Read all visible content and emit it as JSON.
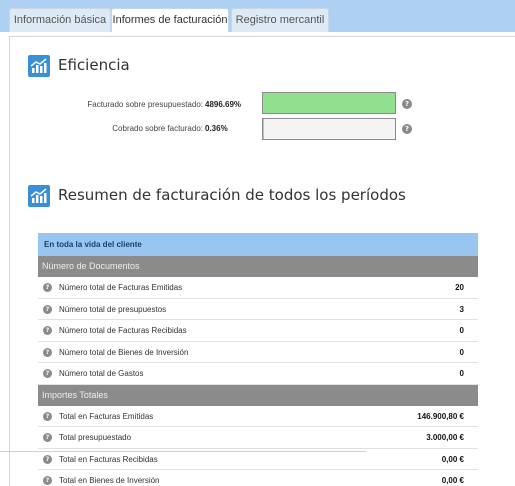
{
  "tabs": [
    {
      "label": "Información básica"
    },
    {
      "label": "Informes de facturación"
    },
    {
      "label": "Registro mercantil"
    }
  ],
  "efficiency": {
    "title": "Eficiencia",
    "rows": [
      {
        "label": "Facturado sobre presupuestado:",
        "value": "4896.69%",
        "fill_percent": 100,
        "fill_color": "#90e08f"
      },
      {
        "label": "Cobrado sobre facturado:",
        "value": "0.36%",
        "fill_percent": 0.36,
        "fill_color": "#90e08f"
      }
    ],
    "help_glyph": "?"
  },
  "summary": {
    "title": "Resumen de facturación de todos los períodos",
    "header": "En toda la vida del cliente",
    "groups": [
      {
        "label": "Número de Documentos",
        "rows": [
          {
            "label": "Número total de Facturas Emitidas",
            "value": "20"
          },
          {
            "label": "Número total de presupuestos",
            "value": "3"
          },
          {
            "label": "Número total de Facturas Recibidas",
            "value": "0"
          },
          {
            "label": "Número total de Bienes de Inversión",
            "value": "0"
          },
          {
            "label": "Número total de Gastos",
            "value": "0"
          }
        ]
      },
      {
        "label": "Importes Totales",
        "rows": [
          {
            "label": "Total en Facturas Emitidas",
            "value": "146.900,80 €"
          },
          {
            "label": "Total presupuestado",
            "value": "3.000,00 €"
          },
          {
            "label": "Total en Facturas Recibidas",
            "value": "0,00 €"
          },
          {
            "label": "Total en Bienes de Inversión",
            "value": "0,00 €"
          }
        ]
      }
    ]
  },
  "icons": {
    "section": "bar-chart-icon",
    "help": "help-icon"
  },
  "colors": {
    "tabbar": "#aed0f2",
    "table_header": "#99c6f0",
    "group_header": "#8b8b8b",
    "icon": "#3a8fd9"
  }
}
